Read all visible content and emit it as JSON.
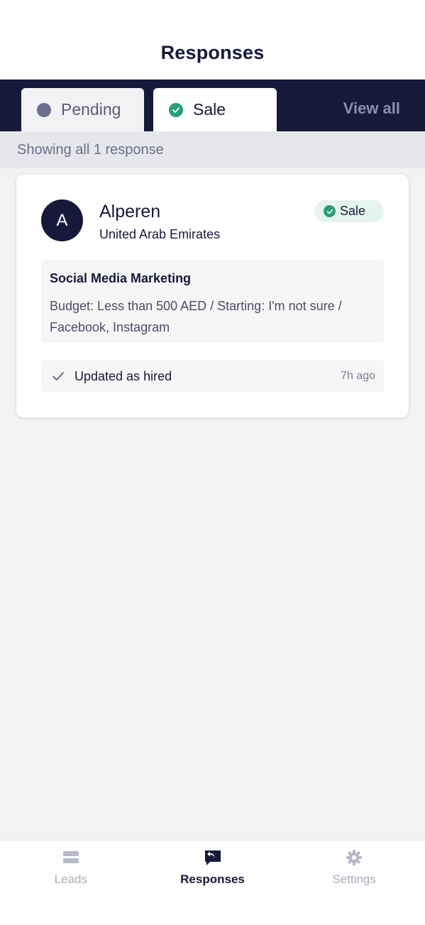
{
  "header": {
    "title": "Responses"
  },
  "tabs": [
    {
      "label": "Pending",
      "icon": "pending-dot-icon"
    },
    {
      "label": "Sale",
      "icon": "check-circle-icon"
    }
  ],
  "view_all_label": "View all",
  "showing_text": "Showing all 1 response",
  "response": {
    "avatar_letter": "A",
    "name": "Alperen",
    "country": "United Arab Emirates",
    "status": "Sale",
    "service": "Social Media Marketing",
    "description": "Budget: Less than 500 AED / Starting: I'm not sure / Facebook, Instagram",
    "update_text": "Updated as hired",
    "update_time": "7h ago"
  },
  "bottom_nav": [
    {
      "label": "Leads",
      "icon": "leads-icon"
    },
    {
      "label": "Responses",
      "icon": "responses-icon",
      "active": true
    },
    {
      "label": "Settings",
      "icon": "gear-icon"
    }
  ],
  "colors": {
    "navy": "#16193a",
    "success": "#2a9d7a",
    "muted": "#8d90ad"
  }
}
